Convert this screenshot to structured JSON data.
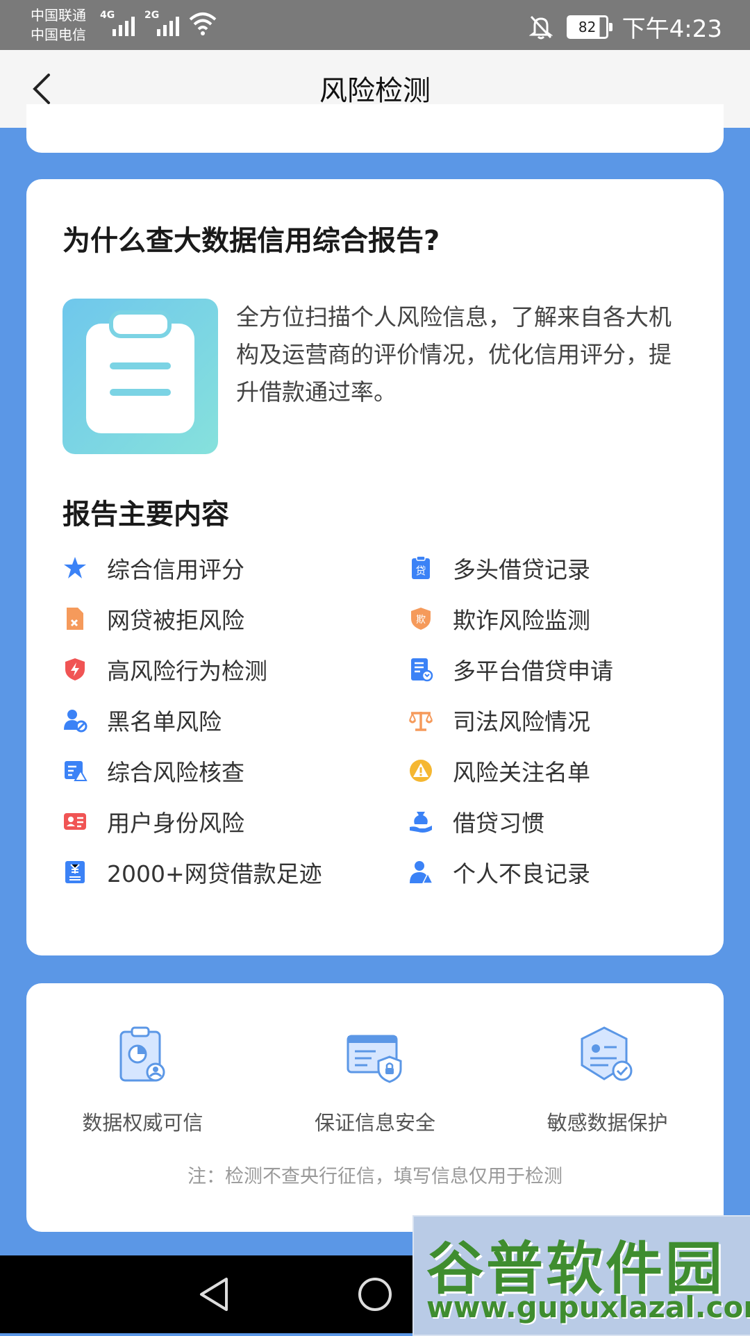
{
  "status_bar": {
    "carrier1": "中国联通",
    "carrier2": "中国电信",
    "net1": "4G",
    "net2": "2G",
    "battery": "82",
    "time": "下午4:23"
  },
  "header": {
    "title": "风险检测"
  },
  "why_section": {
    "title": "为什么查大数据信用综合报告?",
    "description": "全方位扫描个人风险信息，了解来自各大机构及运营商的评价情况，优化信用评分，提升借款通过率。"
  },
  "contents_section": {
    "title": "报告主要内容",
    "left_items": [
      {
        "label": "综合信用评分",
        "icon": "star-icon",
        "color": "#3b82f6"
      },
      {
        "label": "网贷被拒风险",
        "icon": "reject-doc-icon",
        "color": "#f59a5b"
      },
      {
        "label": "高风险行为检测",
        "icon": "lightning-shield-icon",
        "color": "#f05454"
      },
      {
        "label": "黑名单风险",
        "icon": "user-block-icon",
        "color": "#3b82f6"
      },
      {
        "label": "综合风险核查",
        "icon": "check-list-icon",
        "color": "#3b82f6"
      },
      {
        "label": "用户身份风险",
        "icon": "id-card-icon",
        "color": "#f05454"
      },
      {
        "label": "2000+网贷借款足迹",
        "icon": "yuan-doc-icon",
        "color": "#3b82f6"
      }
    ],
    "right_items": [
      {
        "label": "多头借贷记录",
        "icon": "loan-clipboard-icon",
        "color": "#3b82f6",
        "glyph": "贷"
      },
      {
        "label": "欺诈风险监测",
        "icon": "fraud-shield-icon",
        "color": "#f59a5b",
        "glyph": "欺"
      },
      {
        "label": "多平台借贷申请",
        "icon": "apply-doc-icon",
        "color": "#3b82f6"
      },
      {
        "label": "司法风险情况",
        "icon": "scale-icon",
        "color": "#f59a5b"
      },
      {
        "label": "风险关注名单",
        "icon": "warning-icon",
        "color": "#f5b731"
      },
      {
        "label": "借贷习惯",
        "icon": "money-hand-icon",
        "color": "#3b82f6"
      },
      {
        "label": "个人不良记录",
        "icon": "person-alert-icon",
        "color": "#3b82f6"
      }
    ]
  },
  "features": [
    {
      "label": "数据权威可信",
      "icon": "chart-report-icon"
    },
    {
      "label": "保证信息安全",
      "icon": "secure-card-icon"
    },
    {
      "label": "敏感数据保护",
      "icon": "data-protect-icon"
    }
  ],
  "note": "注：检测不查央行征信，填写信息仅用于检测",
  "watermark": {
    "main": "谷普软件园",
    "url": "www.gupuxlazal.com"
  },
  "colors": {
    "background": "#5b97e6",
    "accent": "#3b82f6"
  }
}
